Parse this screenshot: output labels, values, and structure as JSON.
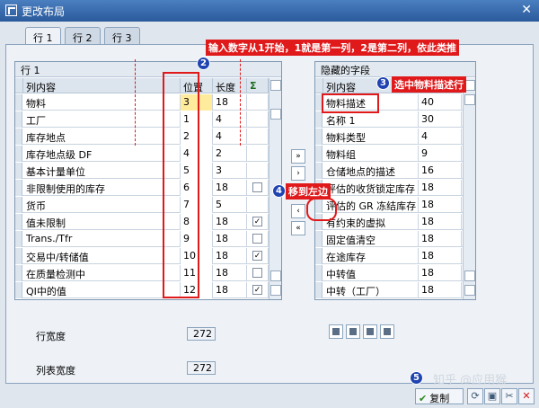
{
  "window": {
    "title": "更改布局"
  },
  "tabs": [
    "行 1",
    "行 2",
    "行 3"
  ],
  "left_panel": {
    "title": "行 1",
    "headers": {
      "content": "列内容",
      "position": "位置",
      "length": "长度",
      "sum": "Σ"
    },
    "rows": [
      {
        "content": "物料",
        "position": "3",
        "length": "18",
        "sum": null
      },
      {
        "content": "工厂",
        "position": "1",
        "length": "4",
        "sum": null
      },
      {
        "content": "库存地点",
        "position": "2",
        "length": "4",
        "sum": null
      },
      {
        "content": "库存地点级 DF",
        "position": "4",
        "length": "2",
        "sum": null
      },
      {
        "content": "基本计量单位",
        "position": "5",
        "length": "3",
        "sum": null
      },
      {
        "content": "非限制使用的库存",
        "position": "6",
        "length": "18",
        "sum": false
      },
      {
        "content": "货币",
        "position": "7",
        "length": "5",
        "sum": null
      },
      {
        "content": "值未限制",
        "position": "8",
        "length": "18",
        "sum": true
      },
      {
        "content": "Trans./Tfr",
        "position": "9",
        "length": "18",
        "sum": false
      },
      {
        "content": "交易中/转储值",
        "position": "10",
        "length": "18",
        "sum": true
      },
      {
        "content": "在质量检测中",
        "position": "11",
        "length": "18",
        "sum": false
      },
      {
        "content": "QI中的值",
        "position": "12",
        "length": "18",
        "sum": true
      }
    ],
    "row_width_label": "行宽度",
    "row_width_value": "272",
    "list_width_label": "列表宽度",
    "list_width_value": "272"
  },
  "right_panel": {
    "title": "隐藏的字段",
    "headers": {
      "content": "列内容",
      "length": "长度"
    },
    "rows": [
      {
        "content": "物料描述",
        "length": "40"
      },
      {
        "content": "名称 1",
        "length": "30"
      },
      {
        "content": "物料类型",
        "length": "4"
      },
      {
        "content": "物料组",
        "length": "9"
      },
      {
        "content": "仓储地点的描述",
        "length": "16"
      },
      {
        "content": "评估的收货锁定库存",
        "length": "18"
      },
      {
        "content": "评估的 GR 冻结库存",
        "length": "18"
      },
      {
        "content": "有约束的虚拟",
        "length": "18"
      },
      {
        "content": "固定值清空",
        "length": "18"
      },
      {
        "content": "在途库存",
        "length": "18"
      },
      {
        "content": "中转值",
        "length": "18"
      },
      {
        "content": "中转（工厂）",
        "length": "18"
      }
    ]
  },
  "move_buttons": [
    "«",
    "‹",
    "›",
    "»"
  ],
  "annotations": {
    "step2": "输入数字从1开始，1就是第一列，2是第二列，依此类推",
    "step3": "选中物料描述行",
    "step4": "移到左边",
    "badges": [
      "2",
      "3",
      "4",
      "5"
    ]
  },
  "footer": {
    "copy_label": "复制",
    "watermark": "知乎 @应用猴"
  },
  "colors": {
    "annotation_red": "#e0191b",
    "badge_blue": "#1f43b0",
    "highlight_yellow": "#ffeb9c"
  }
}
